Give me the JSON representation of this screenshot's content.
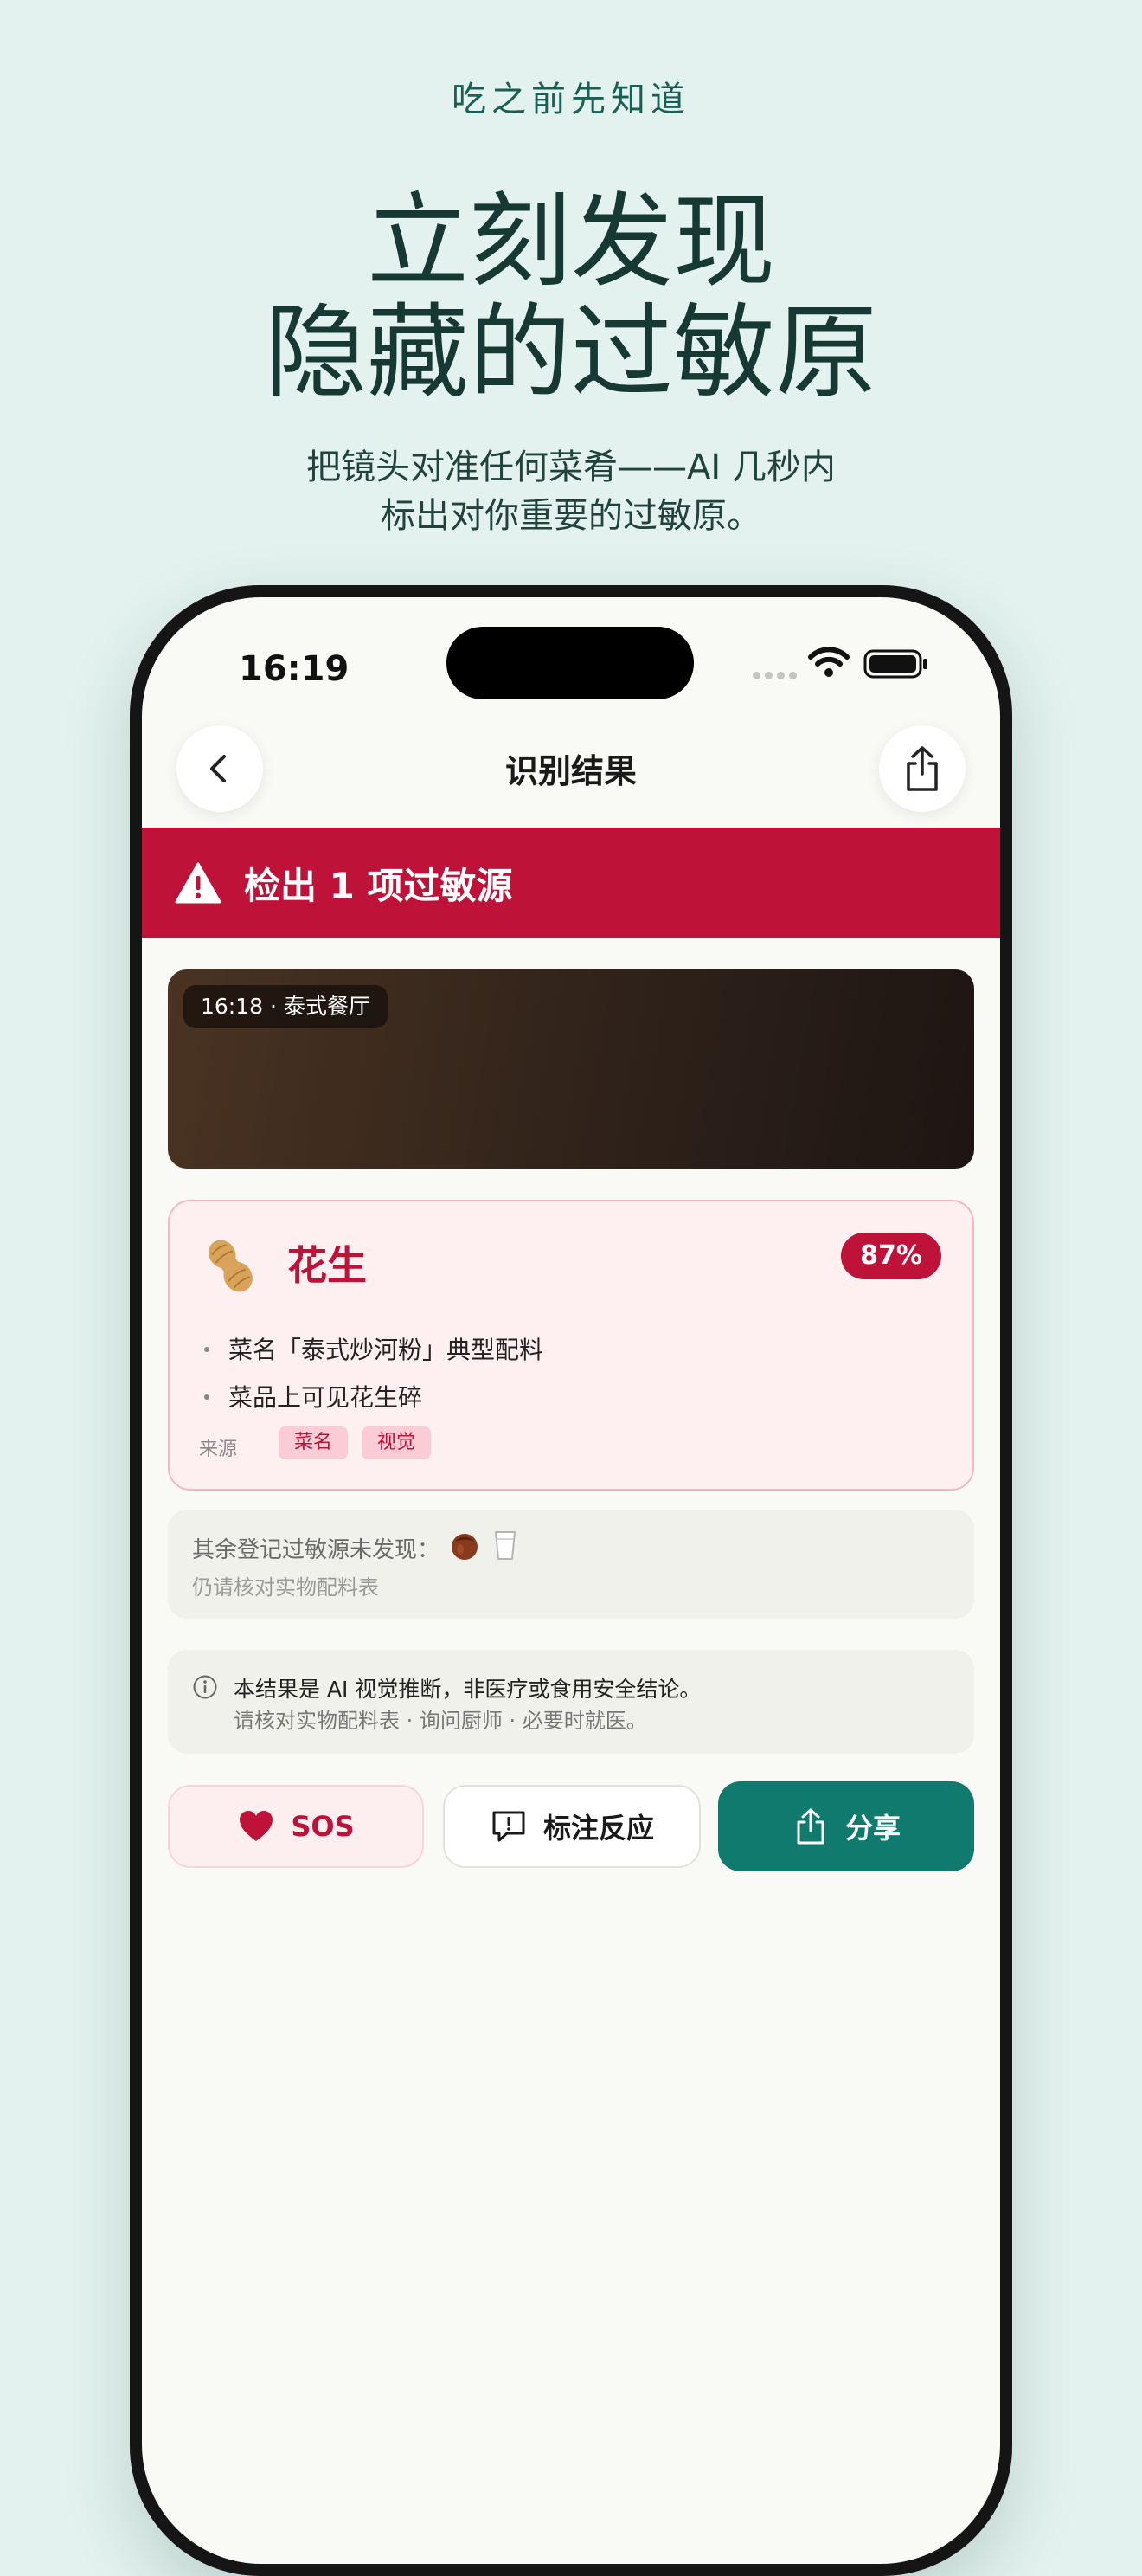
{
  "hero": {
    "eyebrow": "吃之前先知道",
    "headline_line1": "立刻发现",
    "headline_line2": "隐藏的过敏原",
    "sub_line1": "把镜头对准任何菜肴——AI 几秒内",
    "sub_line2": "标出对你重要的过敏原。"
  },
  "status_bar": {
    "time": "16:19"
  },
  "nav": {
    "title": "识别结果",
    "back_icon": "chevron-left-icon",
    "share_icon": "share-icon"
  },
  "alert": {
    "text": "检出 1 项过敏源",
    "icon": "warning-icon"
  },
  "photo": {
    "tag": "16:18 · 泰式餐厅"
  },
  "allergen": {
    "icon": "peanut-icon",
    "name": "花生",
    "confidence": "87%",
    "reasons": [
      "菜名「泰式炒河粉」典型配料",
      "菜品上可见花生碎"
    ],
    "source_label": "来源",
    "sources": [
      "菜名",
      "视觉"
    ]
  },
  "others": {
    "title": "其余登记过敏源未发现：",
    "icons": [
      "hazelnut-icon",
      "milk-icon"
    ],
    "subtitle": "仍请核对实物配料表"
  },
  "disclaimer": {
    "line1": "本结果是 AI 视觉推断，非医疗或食用安全结论。",
    "line2": "请核对实物配料表 · 询问厨师 · 必要时就医。"
  },
  "actions": {
    "sos": "SOS",
    "report": "标注反应",
    "share": "分享"
  },
  "colors": {
    "background": "#E3F2EF",
    "alert_red": "#BF1238",
    "brand_teal": "#107A6E",
    "heading_dark": "#163A33"
  }
}
